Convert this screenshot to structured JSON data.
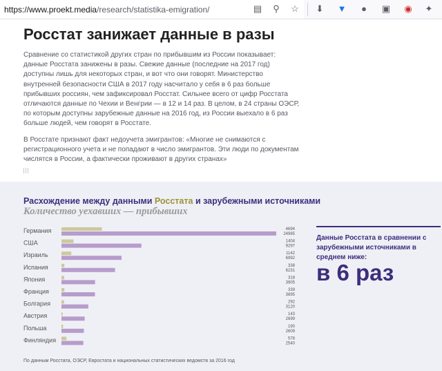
{
  "browser": {
    "url_host": "https://www.proekt.media",
    "url_path": "/research/statistika-emigration/"
  },
  "article": {
    "title": "Росстат занижает данные в разы",
    "paragraph1": "Сравнение со статистикой других стран по прибывшим из России показывает: данные Росстата занижены в разы. Свежие данные (последние на 2017 год) доступны лишь для некоторых стран, и вот что они говорят. Министерство внутренней безопасности США в 2017 году насчитало у себя в 6 раз больше прибывших россиян, чем зафиксировал Росстат. Сильнее всего от цифр Росстата отличаются данные по Чехии и Венгрии — в 12 и 14 раз. В целом, в 24 страны ОЭСР, по которым доступны зарубежные данные на 2016 год, из России выехало в 6 раз больше людей, чем говорят в Росстате.",
    "paragraph2": "В Росстате признают факт недоучета эмигрантов: «Многие не снимаются с регистрационного учета и не попадают в число эмигрантов. Эти люди по документам числятся в России, а фактически проживают в других странах»"
  },
  "infographic": {
    "heading_part1": "Расхождение между данными ",
    "heading_part2": "Росстата",
    "heading_part3": " и ",
    "heading_part4": "зарубежными источниками",
    "subheading": "Количество уехавших — прибывших",
    "source": "По данным Росстата, ОЭСР, Евростата и национальных статистических ведомств за 2016 год",
    "callout_text": "Данные Росстата в сравнении с зарубежными источниками в среднем ниже:",
    "callout_big": "в 6 раз",
    "colors": {
      "rosstat": "#cdc99a",
      "foreign": "#b79ccc",
      "accent": "#3e2d7d",
      "olive": "#9b9238"
    }
  },
  "chart_data": {
    "type": "bar",
    "orientation": "horizontal",
    "categories": [
      "Германия",
      "США",
      "Израиль",
      "Испания",
      "Япония",
      "Франция",
      "Болгария",
      "Австрия",
      "Польша",
      "Финляндия"
    ],
    "series": [
      {
        "name": "Росстата",
        "values": [
          4694,
          1404,
          1142,
          338,
          318,
          339,
          292,
          143,
          190,
          578
        ]
      },
      {
        "name": "зарубежными источниками",
        "values": [
          24985,
          9297,
          6992,
          6231,
          3905,
          3895,
          3120,
          2699,
          2609,
          2540
        ]
      }
    ]
  }
}
